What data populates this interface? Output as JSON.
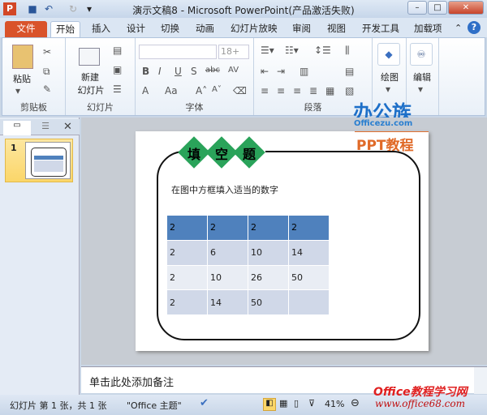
{
  "window": {
    "title": "演示文稿8 - Microsoft PowerPoint(产品激活失败)",
    "app_icon": "P"
  },
  "tabs": [
    "文件",
    "开始",
    "插入",
    "设计",
    "切换",
    "动画",
    "幻灯片放映",
    "审阅",
    "视图",
    "开发工具",
    "加载项"
  ],
  "ribbon": {
    "clipboard": {
      "label": "剪贴板",
      "paste": "粘贴"
    },
    "slides": {
      "label": "幻灯片",
      "new_slide": "新建",
      "new_slide2": "幻灯片"
    },
    "font": {
      "label": "字体",
      "size": "18+",
      "bold": "B",
      "italic": "I",
      "underline": "U",
      "shadow": "S",
      "strike": "abc",
      "spacing": "AV",
      "color": "A",
      "case": "Aa"
    },
    "paragraph": {
      "label": "段落"
    },
    "drawing": {
      "label": "绘图"
    },
    "editing": {
      "label": "编辑"
    }
  },
  "thumbnail": {
    "number": "1"
  },
  "slide": {
    "title_chars": [
      "填",
      "空",
      "题"
    ],
    "instruction": "在图中方框填入适当的数字",
    "table": [
      [
        "2",
        "2",
        "2",
        "2"
      ],
      [
        "2",
        "6",
        "10",
        "14"
      ],
      [
        "2",
        "10",
        "26",
        "50"
      ],
      [
        "2",
        "14",
        "50",
        ""
      ]
    ],
    "header_color": "#4f81bd"
  },
  "watermark": {
    "brand": "办公族",
    "site": "Officezu.com",
    "ppt": "PPT教程",
    "bottom1": "Office教程学习网",
    "bottom2": "www.office68.com"
  },
  "notes": {
    "placeholder": "单击此处添加备注"
  },
  "status": {
    "slide_info": "幻灯片 第 1 张，共 1 张",
    "theme": "\"Office 主题\"",
    "zoom": "41%"
  }
}
